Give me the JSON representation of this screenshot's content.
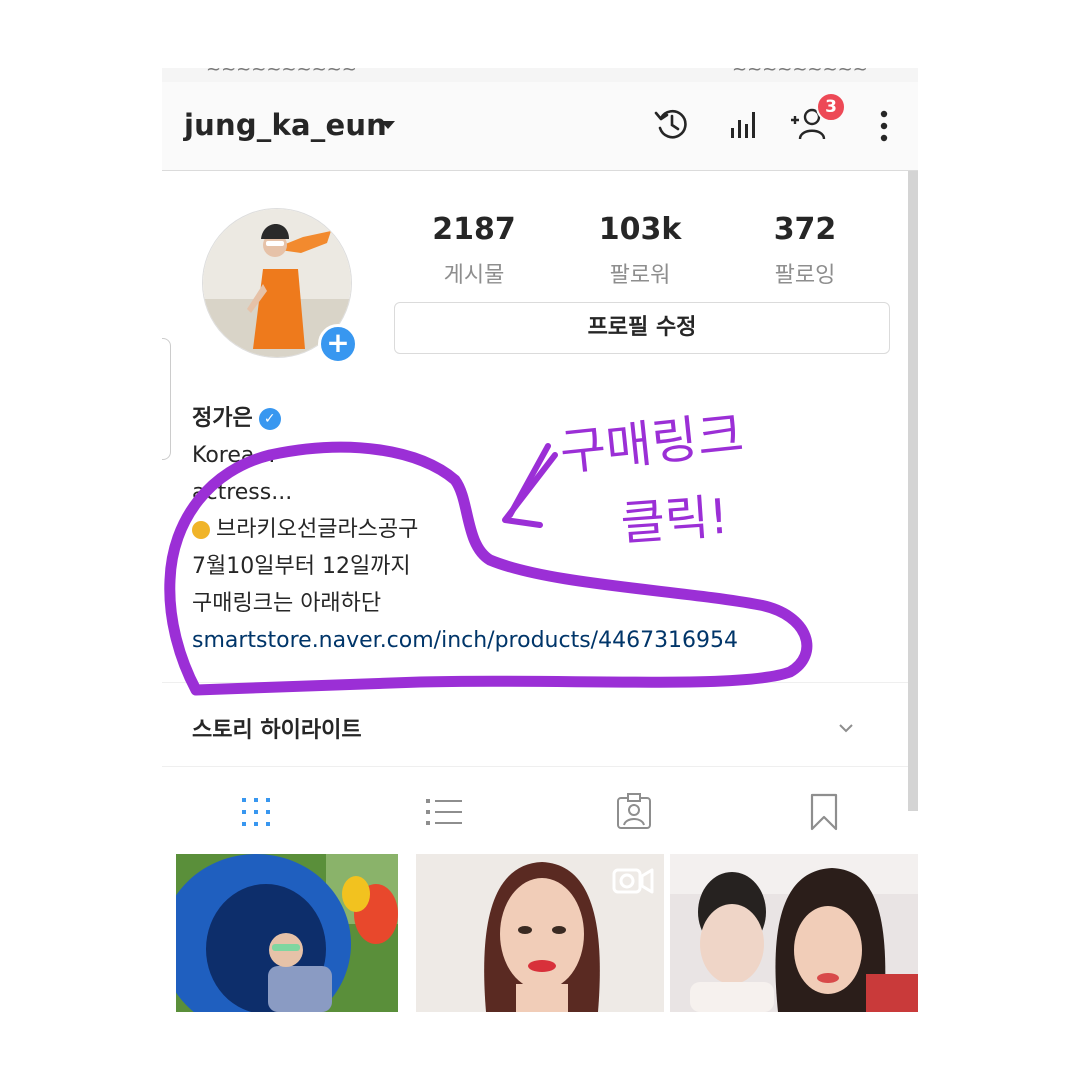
{
  "header": {
    "username": "jung_ka_eun",
    "notification_count": "3"
  },
  "profile": {
    "stats": [
      {
        "number": "2187",
        "label": "게시물"
      },
      {
        "number": "103k",
        "label": "팔로워"
      },
      {
        "number": "372",
        "label": "팔로잉"
      }
    ],
    "edit_button_label": "프로필 수정",
    "name": "정가은",
    "bio_lines": [
      "Korea...",
      "actress...",
      "브라키오선글라스공구",
      "7월10일부터 12일까지",
      "구매링크는 아래하단"
    ],
    "link": "smartstore.naver.com/inch/products/4467316954"
  },
  "highlights": {
    "label": "스토리 하이라이트"
  },
  "annotation": {
    "line1": "구매링크",
    "line2": "클릭!",
    "color": "#9b2fd6"
  },
  "icons": [
    "history-icon",
    "insights-icon",
    "add-user-icon",
    "more-options-icon",
    "grid-view-icon",
    "list-view-icon",
    "tagged-icon",
    "saved-icon"
  ],
  "colors": {
    "accent": "#3897f0",
    "badge": "#ed4956",
    "link": "#003569",
    "annotation": "#9b2fd6"
  }
}
